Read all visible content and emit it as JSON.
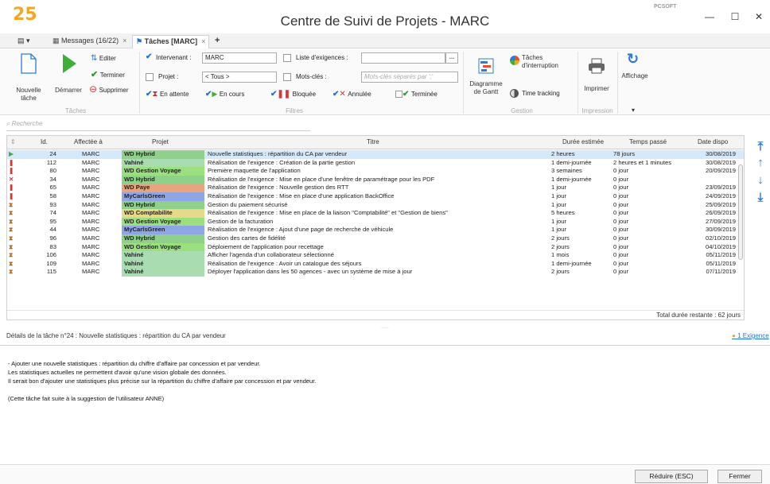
{
  "app": {
    "logo": "25",
    "title": "Centre de Suivi de Projets - MARC",
    "brand": "PCSOFT"
  },
  "tabs": [
    {
      "label": "Messages (16/22)"
    },
    {
      "label": "Tâches [MARC]"
    }
  ],
  "ribbon": {
    "taches": {
      "nouvelle": "Nouvelle tâche",
      "demarrer": "Démarrer",
      "editer": "Editer",
      "terminer": "Terminer",
      "supprimer": "Supprimer",
      "group": "Tâches"
    },
    "filtres": {
      "intervenant_label": "Intervenant :",
      "intervenant_value": "MARC",
      "projet_label": "Projet :",
      "projet_value": "< Tous >",
      "exigences_label": "Liste d'exigences :",
      "motscles_label": "Mots-clés :",
      "motscles_placeholder": "Mots-clés séparés par ';'",
      "statuts": [
        "En attente",
        "En cours",
        "Bloquée",
        "Annulée",
        "Terminée"
      ],
      "group": "Filtres"
    },
    "gestion": {
      "gantt": "Diagramme de Gantt",
      "interruption": "Tâches d'interruption",
      "timetracking": "Time tracking",
      "group": "Gestion"
    },
    "impression": {
      "imprimer": "Imprimer",
      "group": "Impression"
    },
    "affichage": "Affichage"
  },
  "search": {
    "placeholder": "Recherche"
  },
  "table": {
    "headers": [
      "Id.",
      "Affectée à",
      "Projet",
      "Titre",
      "Durée estimée",
      "Temps passé",
      "Date dispo"
    ],
    "rows": [
      {
        "id": "24",
        "aff": "MARC",
        "projet": "WD Hybrid",
        "titre": "Nouvelle statistiques : répartition du CA par vendeur",
        "duree": "2 heures",
        "temps": "78 jours",
        "date": "30/08/2019",
        "status": "en-cours",
        "color": "#8fd18a"
      },
      {
        "id": "112",
        "aff": "MARC",
        "projet": "Vahiné",
        "titre": "Réalisation de l'exigence : Création de la partie gestion",
        "duree": "1 demi-journée",
        "temps": "2 heures et 1 minutes",
        "date": "30/08/2019",
        "status": "bloquee",
        "color": "#a9dcb0"
      },
      {
        "id": "80",
        "aff": "MARC",
        "projet": "WD Gestion Voyage",
        "titre": "Première maquette de l'application",
        "duree": "3 semaines",
        "temps": "0 jour",
        "date": "20/09/2019",
        "status": "bloquee",
        "color": "#9be07f"
      },
      {
        "id": "34",
        "aff": "MARC",
        "projet": "WD Hybrid",
        "titre": "Réalisation de l'exigence : Mise en place d'une fenêtre de paramétrage pour les PDF",
        "duree": "1 demi-journée",
        "temps": "0 jour",
        "date": "",
        "status": "annulee",
        "color": "#8fd18a"
      },
      {
        "id": "65",
        "aff": "MARC",
        "projet": "WD Paye",
        "titre": "Réalisation de l'exigence : Nouvelle gestion des RTT",
        "duree": "1 jour",
        "temps": "0 jour",
        "date": "23/09/2019",
        "status": "bloquee",
        "color": "#e8a47e"
      },
      {
        "id": "58",
        "aff": "MARC",
        "projet": "MyCarlsGreen",
        "titre": "Réalisation de l'exigence : Mise en place d'une application BackOffice",
        "duree": "1 jour",
        "temps": "0 jour",
        "date": "24/09/2019",
        "status": "bloquee",
        "color": "#8ea5e6"
      },
      {
        "id": "93",
        "aff": "MARC",
        "projet": "WD Hybrid",
        "titre": "Gestion du paiement sécurisé",
        "duree": "1 jour",
        "temps": "0 jour",
        "date": "25/09/2019",
        "status": "attente",
        "color": "#8fd18a"
      },
      {
        "id": "74",
        "aff": "MARC",
        "projet": "WD Comptabilite",
        "titre": "Réalisation de l'exigence : Mise en place de la liaison \"Comptabilité\" et \"Gestion de biens\"",
        "duree": "5 heures",
        "temps": "0 jour",
        "date": "26/09/2019",
        "status": "attente",
        "color": "#e6d98a"
      },
      {
        "id": "95",
        "aff": "MARC",
        "projet": "WD Gestion Voyage",
        "titre": "Gestion de la facturation",
        "duree": "1 jour",
        "temps": "0 jour",
        "date": "27/09/2019",
        "status": "attente",
        "color": "#9be07f"
      },
      {
        "id": "44",
        "aff": "MARC",
        "projet": "MyCarlsGreen",
        "titre": "Réalisation de l'exigence : Ajout d'une page de recherche de véhicule",
        "duree": "1 jour",
        "temps": "0 jour",
        "date": "30/09/2019",
        "status": "attente",
        "color": "#8ea5e6"
      },
      {
        "id": "96",
        "aff": "MARC",
        "projet": "WD Hybrid",
        "titre": "Gestion des cartes de fidélité",
        "duree": "2 jours",
        "temps": "0 jour",
        "date": "02/10/2019",
        "status": "attente",
        "color": "#8fd18a"
      },
      {
        "id": "83",
        "aff": "MARC",
        "projet": "WD Gestion Voyage",
        "titre": "Déploiement de l'application pour recettage",
        "duree": "2 jours",
        "temps": "0 jour",
        "date": "04/10/2019",
        "status": "attente",
        "color": "#9be07f"
      },
      {
        "id": "106",
        "aff": "MARC",
        "projet": "Vahiné",
        "titre": "Afficher l'agenda d'un collaborateur sélectionné",
        "duree": "1 mois",
        "temps": "0 jour",
        "date": "05/11/2019",
        "status": "attente",
        "color": "#a9dcb0"
      },
      {
        "id": "109",
        "aff": "MARC",
        "projet": "Vahiné",
        "titre": "Réalisation de l'exigence : Avoir un catalogue des séjours",
        "duree": "1 demi-journée",
        "temps": "0 jour",
        "date": "05/11/2019",
        "status": "attente",
        "color": "#a9dcb0"
      },
      {
        "id": "115",
        "aff": "MARC",
        "projet": "Vahiné",
        "titre": "Déployer l'application dans les 50 agences - avec un système de mise à jour",
        "duree": "2 jours",
        "temps": "0 jour",
        "date": "07/11/2019",
        "status": "attente",
        "color": "#a9dcb0"
      }
    ],
    "total": "Total durée restante : 62 jours"
  },
  "details": {
    "header": "Détails de la tâche n°24 : Nouvelle statistiques : répartition du CA par vendeur",
    "exigence_link": "1 Exigence",
    "lines": [
      "- Ajouter une nouvelle statistiques : répartition du chiffre d'affaire par concession et par vendeur.",
      "Les statistiques actuelles ne permettent d'avoir qu'une vision globale des données.",
      "Il serait bon d'ajouter une statistiques plus précise sur la répartition du chiffre d'affaire par concession et par vendeur.",
      "",
      "(Cette tâche fait suite à la suggestion de l'utilisateur ANNE)"
    ]
  },
  "footer": {
    "reduire": "Réduire (ESC)",
    "fermer": "Fermer"
  }
}
